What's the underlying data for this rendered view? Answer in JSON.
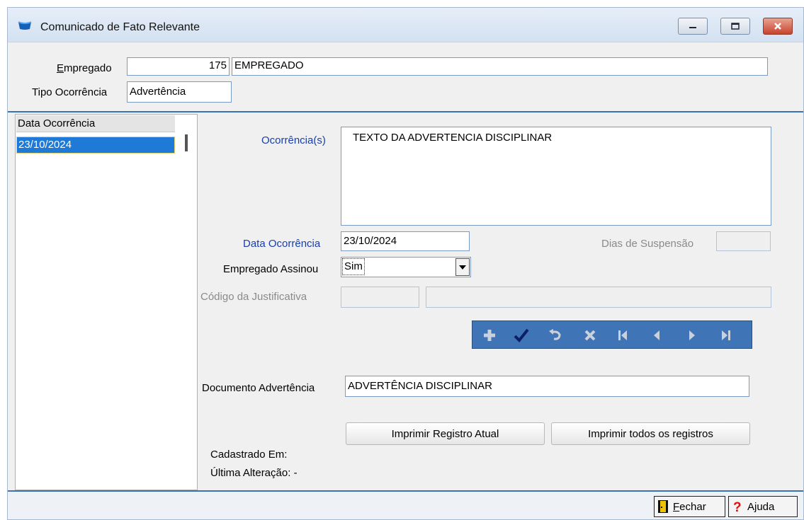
{
  "window": {
    "title": "Comunicado de Fato Relevante"
  },
  "header": {
    "empregado_label": "Empregado",
    "empregado_code": "175",
    "empregado_name": "EMPREGADO",
    "tipo_label": "Tipo Ocorrência",
    "tipo_value": "Advertência"
  },
  "list": {
    "column_header": "Data Ocorrência",
    "rows": [
      "23/10/2024"
    ]
  },
  "form": {
    "ocorrencias_label": "Ocorrência(s)",
    "ocorrencias_text": "TEXTO DA ADVERTENCIA DISCIPLINAR",
    "data_ocorrencia_label": "Data Ocorrência",
    "data_ocorrencia_value": "23/10/2024",
    "dias_suspensao_label": "Dias de Suspensão",
    "dias_suspensao_value": "",
    "empregado_assinou_label": "Empregado Assinou",
    "empregado_assinou_value": "Sim",
    "codigo_justificativa_label": "Código da Justificativa",
    "codigo_justificativa_value": "",
    "justificativa_desc_value": "",
    "documento_label": "Documento Advertência",
    "documento_value": "ADVERTÊNCIA DISCIPLINAR"
  },
  "navigator": {
    "buttons": [
      "add-icon",
      "confirm-icon",
      "undo-icon",
      "delete-icon",
      "first-icon",
      "prior-icon",
      "next-icon",
      "last-icon"
    ]
  },
  "actions": {
    "print_current": "Imprimir Registro Atual",
    "print_all": "Imprimir todos os registros"
  },
  "audit": {
    "cadastrado_label": "Cadastrado Em:",
    "cadastrado_value": "",
    "alteracao_label": "Última Alteração:",
    "alteracao_value": "-"
  },
  "statusbar": {
    "fechar_accel": "F",
    "fechar_rest": "echar",
    "ajuda_label": "Ajuda"
  },
  "colors": {
    "accent_blue": "#3a72b8",
    "selection": "#1e7ad6",
    "label_blue": "#1a3ea8"
  }
}
